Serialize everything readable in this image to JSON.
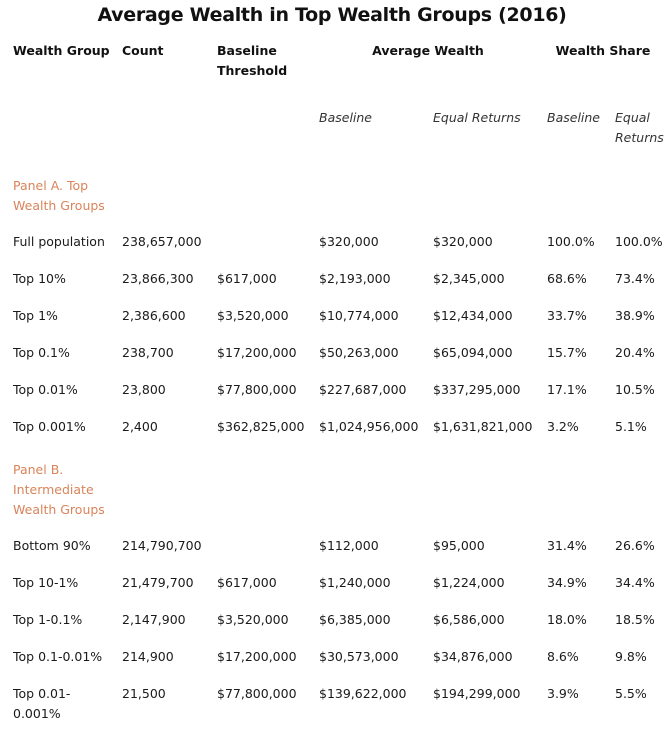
{
  "title": "Average Wealth in Top Wealth Groups (2016)",
  "headers": {
    "wealth_group": "Wealth Group",
    "count": "Count",
    "baseline_threshold": "Baseline Threshold",
    "average_wealth": "Average Wealth",
    "wealth_share": "Wealth Share"
  },
  "subheaders": {
    "avg_baseline": "Baseline",
    "avg_equal_returns": "Equal Returns",
    "share_baseline": "Baseline",
    "share_equal_returns": "Equal Returns"
  },
  "panel_color": "#d9845a",
  "panels": [
    {
      "label": "Panel A. Top Wealth Groups",
      "rows": [
        {
          "group": "Full population",
          "count": "238,657,000",
          "threshold": "",
          "avg_baseline": "$320,000",
          "avg_equal": "$320,000",
          "share_baseline": "100.0%",
          "share_equal": "100.0%"
        },
        {
          "group": "Top 10%",
          "count": "23,866,300",
          "threshold": "$617,000",
          "avg_baseline": "$2,193,000",
          "avg_equal": "$2,345,000",
          "share_baseline": "68.6%",
          "share_equal": "73.4%"
        },
        {
          "group": "Top 1%",
          "count": "2,386,600",
          "threshold": "$3,520,000",
          "avg_baseline": "$10,774,000",
          "avg_equal": "$12,434,000",
          "share_baseline": "33.7%",
          "share_equal": "38.9%"
        },
        {
          "group": "Top 0.1%",
          "count": "238,700",
          "threshold": "$17,200,000",
          "avg_baseline": "$50,263,000",
          "avg_equal": "$65,094,000",
          "share_baseline": "15.7%",
          "share_equal": "20.4%"
        },
        {
          "group": "Top 0.01%",
          "count": "23,800",
          "threshold": "$77,800,000",
          "avg_baseline": "$227,687,000",
          "avg_equal": "$337,295,000",
          "share_baseline": "17.1%",
          "share_equal": "10.5%"
        },
        {
          "group": "Top 0.001%",
          "count": "2,400",
          "threshold": "$362,825,000",
          "avg_baseline": "$1,024,956,000",
          "avg_equal": "$1,631,821,000",
          "share_baseline": "3.2%",
          "share_equal": "5.1%"
        }
      ]
    },
    {
      "label": "Panel B. Intermediate Wealth Groups",
      "rows": [
        {
          "group": "Bottom 90%",
          "count": "214,790,700",
          "threshold": "",
          "avg_baseline": "$112,000",
          "avg_equal": "$95,000",
          "share_baseline": "31.4%",
          "share_equal": "26.6%"
        },
        {
          "group": "Top 10-1%",
          "count": "21,479,700",
          "threshold": "$617,000",
          "avg_baseline": "$1,240,000",
          "avg_equal": "$1,224,000",
          "share_baseline": "34.9%",
          "share_equal": "34.4%"
        },
        {
          "group": "Top 1-0.1%",
          "count": "2,147,900",
          "threshold": "$3,520,000",
          "avg_baseline": "$6,385,000",
          "avg_equal": "$6,586,000",
          "share_baseline": "18.0%",
          "share_equal": "18.5%"
        },
        {
          "group": "Top 0.1-0.01%",
          "count": "214,900",
          "threshold": "$17,200,000",
          "avg_baseline": "$30,573,000",
          "avg_equal": "$34,876,000",
          "share_baseline": "8.6%",
          "share_equal": "9.8%"
        },
        {
          "group": "Top 0.01-0.001%",
          "count": "21,500",
          "threshold": "$77,800,000",
          "avg_baseline": "$139,622,000",
          "avg_equal": "$194,299,000",
          "share_baseline": "3.9%",
          "share_equal": "5.5%"
        }
      ]
    }
  ]
}
